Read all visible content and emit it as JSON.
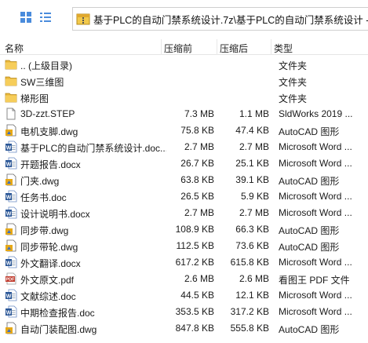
{
  "toolbar": {
    "path": "基于PLC的自动门禁系统设计.7z\\基于PLC的自动门禁系统设计 - 解",
    "icons": [
      "grid-view-icon",
      "list-view-icon",
      "archive-icon"
    ]
  },
  "header": {
    "name": "名称",
    "compressed": "压缩前",
    "original": "压缩后",
    "type": "类型"
  },
  "files": [
    {
      "name": ".. (上级目录)",
      "compressed": "",
      "original": "",
      "type": "文件夹",
      "icon": "folder"
    },
    {
      "name": "SW三维图",
      "compressed": "",
      "original": "",
      "type": "文件夹",
      "icon": "folder"
    },
    {
      "name": "梯形图",
      "compressed": "",
      "original": "",
      "type": "文件夹",
      "icon": "folder"
    },
    {
      "name": "3D-zzt.STEP",
      "compressed": "7.3 MB",
      "original": "1.1 MB",
      "type": "SldWorks 2019 ...",
      "icon": "blank"
    },
    {
      "name": "电机支脚.dwg",
      "compressed": "75.8 KB",
      "original": "47.4 KB",
      "type": "AutoCAD 图形",
      "icon": "dwg"
    },
    {
      "name": "基于PLC的自动门禁系统设计.doc...",
      "compressed": "2.7 MB",
      "original": "2.7 MB",
      "type": "Microsoft Word ...",
      "icon": "word"
    },
    {
      "name": "开题报告.docx",
      "compressed": "26.7 KB",
      "original": "25.1 KB",
      "type": "Microsoft Word ...",
      "icon": "word"
    },
    {
      "name": "门夹.dwg",
      "compressed": "63.8 KB",
      "original": "39.1 KB",
      "type": "AutoCAD 图形",
      "icon": "dwg"
    },
    {
      "name": "任务书.doc",
      "compressed": "26.5 KB",
      "original": "5.9 KB",
      "type": "Microsoft Word ...",
      "icon": "word"
    },
    {
      "name": "设计说明书.docx",
      "compressed": "2.7 MB",
      "original": "2.7 MB",
      "type": "Microsoft Word ...",
      "icon": "word"
    },
    {
      "name": "同步带.dwg",
      "compressed": "108.9 KB",
      "original": "66.3 KB",
      "type": "AutoCAD 图形",
      "icon": "dwg"
    },
    {
      "name": "同步带轮.dwg",
      "compressed": "112.5 KB",
      "original": "73.6 KB",
      "type": "AutoCAD 图形",
      "icon": "dwg"
    },
    {
      "name": "外文翻译.docx",
      "compressed": "617.2 KB",
      "original": "615.8 KB",
      "type": "Microsoft Word ...",
      "icon": "word"
    },
    {
      "name": "外文原文.pdf",
      "compressed": "2.6 MB",
      "original": "2.6 MB",
      "type": "看图王 PDF 文件",
      "icon": "pdf"
    },
    {
      "name": "文献综述.doc",
      "compressed": "44.5 KB",
      "original": "12.1 KB",
      "type": "Microsoft Word ...",
      "icon": "word"
    },
    {
      "name": "中期检查报告.doc",
      "compressed": "353.5 KB",
      "original": "317.2 KB",
      "type": "Microsoft Word ...",
      "icon": "word"
    },
    {
      "name": "自动门装配图.dwg",
      "compressed": "847.8 KB",
      "original": "555.8 KB",
      "type": "AutoCAD 图形",
      "icon": "dwg"
    }
  ],
  "colors": {
    "folder": "#e8b73a",
    "word": "#2b5797",
    "dwg": "#e6a817",
    "pdf": "#c0392b"
  }
}
